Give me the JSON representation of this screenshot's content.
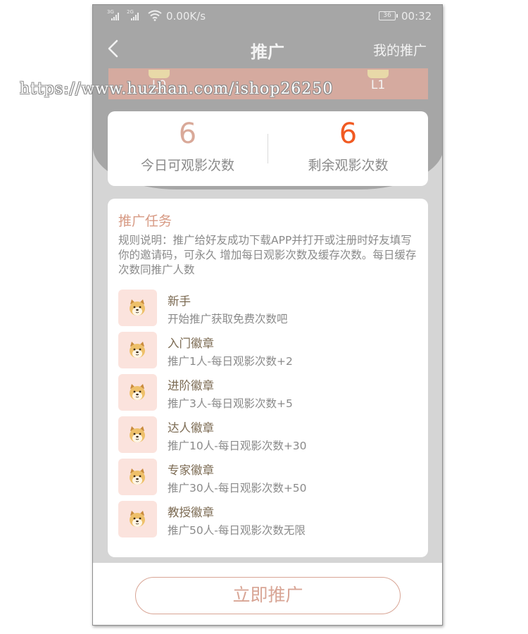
{
  "status_bar": {
    "network_1": "3G",
    "network_2": "2G",
    "speed": "0.00K/s",
    "battery": "36",
    "time": "00:32",
    "icons": [
      "signal-icon",
      "wifi-icon",
      "battery-icon"
    ]
  },
  "nav": {
    "title": "推广",
    "right_link": "我的推广",
    "back_icon": "chevron-left-icon"
  },
  "levels": [
    {
      "label": "L0"
    },
    {
      "label": "L1"
    }
  ],
  "stats": {
    "today": {
      "value": "6",
      "label": "今日可观影次数",
      "color": "#d9a999"
    },
    "remaining": {
      "value": "6",
      "label": "剩余观影次数",
      "color": "#f15a22"
    }
  },
  "tasks_section": {
    "title": "推广任务",
    "rules": "规则说明：推广给好友成功下载APP并打开或注册时好友填写你的邀请码，可永久 增加每日观影次数及缓存次数。每日缓存次数同推广人数",
    "items": [
      {
        "name": "新手",
        "desc": "开始推广获取免费次数吧",
        "icon": "shiba-dog-icon"
      },
      {
        "name": "入门徽章",
        "desc": "推广1人-每日观影次数+2",
        "icon": "shiba-dog-icon"
      },
      {
        "name": "进阶徽章",
        "desc": "推广3人-每日观影次数+5",
        "icon": "shiba-dog-icon"
      },
      {
        "name": "达人徽章",
        "desc": "推广10人-每日观影次数+30",
        "icon": "shiba-dog-icon"
      },
      {
        "name": "专家徽章",
        "desc": "推广30人-每日观影次数+50",
        "icon": "shiba-dog-icon"
      },
      {
        "name": "教授徽章",
        "desc": "推广50人-每日观影次数无限",
        "icon": "shiba-dog-icon"
      }
    ]
  },
  "cta": {
    "label": "立即推广"
  },
  "watermark": "https://www.huzhan.com/ishop26250",
  "colors": {
    "header_bg": "#a6a6a6",
    "page_bg": "#d5d5d5",
    "accent": "#d8a595",
    "highlight": "#f15a22",
    "badge_bg": "#fbe3dd"
  }
}
